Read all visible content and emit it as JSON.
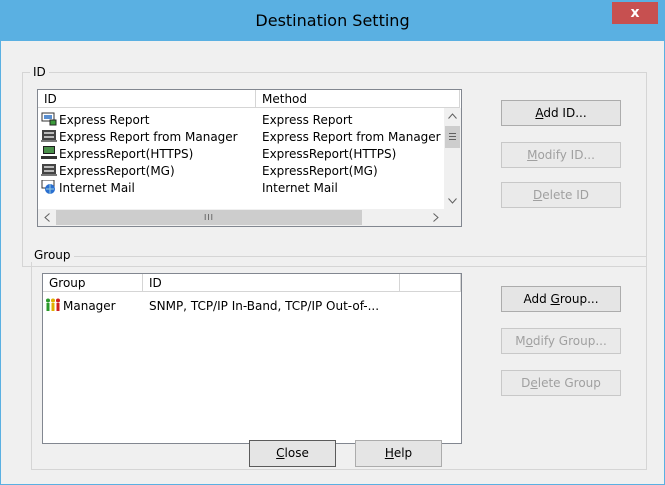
{
  "window": {
    "title": "Destination Setting",
    "close_glyph": "x"
  },
  "id_group": {
    "legend": "ID",
    "columns": [
      "ID",
      "Method"
    ],
    "rows": [
      {
        "id": "Express Report",
        "method": "Express Report",
        "icon": "express-report-icon"
      },
      {
        "id": "Express Report from Manager",
        "method": "Express Report from Manager",
        "icon": "server-icon"
      },
      {
        "id": "ExpressReport(HTTPS)",
        "method": "ExpressReport(HTTPS)",
        "icon": "computer-icon"
      },
      {
        "id": "ExpressReport(MG)",
        "method": "ExpressReport(MG)",
        "icon": "server-icon"
      },
      {
        "id": "Internet Mail",
        "method": "Internet Mail",
        "icon": "globe-mail-icon"
      }
    ],
    "buttons": {
      "add": {
        "pre": "",
        "key": "A",
        "post": "dd ID..."
      },
      "modify": {
        "pre": "",
        "key": "M",
        "post": "odify ID..."
      },
      "delete": {
        "pre": "",
        "key": "D",
        "post": "elete ID"
      }
    },
    "hscroll_thumb_glyph": "III"
  },
  "group_group": {
    "legend": "Group",
    "columns": [
      "Group",
      "ID"
    ],
    "rows": [
      {
        "group": "Manager",
        "id": "SNMP, TCP/IP In-Band, TCP/IP Out-of-...",
        "icon": "people-group-icon"
      }
    ],
    "buttons": {
      "add": {
        "pre": "Add ",
        "key": "G",
        "post": "roup..."
      },
      "modify": {
        "pre": "M",
        "key": "o",
        "post": "dify Group..."
      },
      "delete": {
        "pre": "D",
        "key": "e",
        "post": "lete Group"
      }
    }
  },
  "footer": {
    "close": {
      "pre": "",
      "key": "C",
      "post": "lose"
    },
    "help": {
      "pre": "",
      "key": "H",
      "post": "elp"
    }
  },
  "colors": {
    "titlebar": "#5ab0e2",
    "close_button": "#c75050",
    "dialog_bg": "#f0f0f0"
  }
}
